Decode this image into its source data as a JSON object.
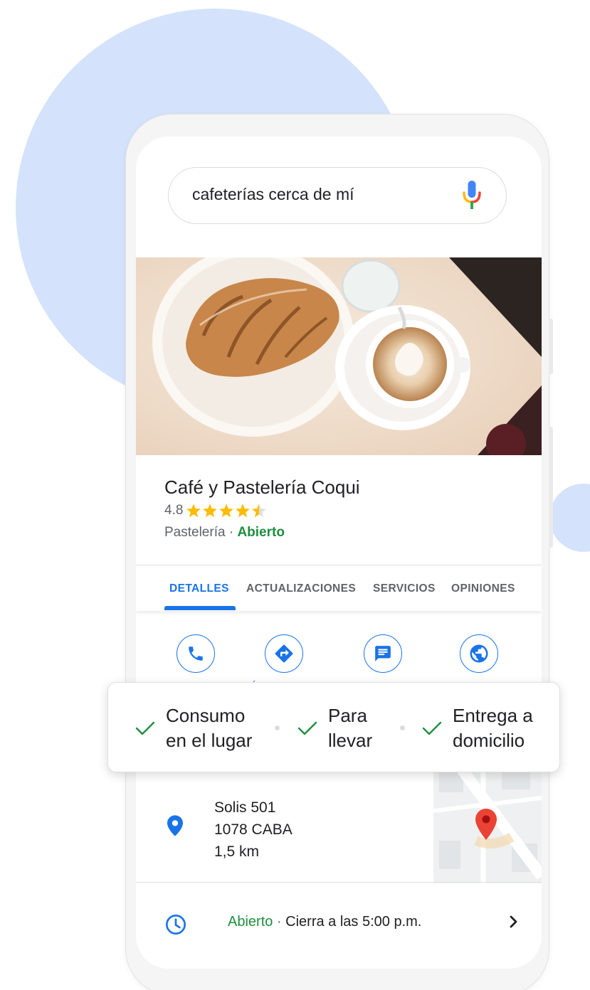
{
  "search": {
    "query": "cafeterías cerca de mí"
  },
  "business": {
    "name": "Café y Pastelería Coqui",
    "rating": "4.8",
    "stars": 4.5,
    "category": "Pastelería",
    "separator": " · ",
    "status": "Abierto"
  },
  "tabs": [
    {
      "label": "DETALLES",
      "active": true
    },
    {
      "label": "ACTUALIZACIONES",
      "active": false
    },
    {
      "label": "SERVICIOS",
      "active": false
    },
    {
      "label": "OPINIONES",
      "active": false
    }
  ],
  "actions": [
    {
      "icon": "phone-icon"
    },
    {
      "icon": "directions-icon"
    },
    {
      "icon": "message-icon"
    },
    {
      "icon": "website-icon"
    }
  ],
  "features": [
    {
      "label": "Consumo\nen el lugar"
    },
    {
      "label": "Para\nllevar"
    },
    {
      "label": "Entrega a\ndomicilio"
    }
  ],
  "address": {
    "line1": "Solis 501",
    "line2": "1078 CABA",
    "distance": "1,5 km"
  },
  "hours": {
    "status": "Abierto",
    "separator": " · ",
    "closes": "Cierra a las 5:00 p.m."
  },
  "colors": {
    "accent": "#1a73e8",
    "open": "#1e8e3e",
    "star": "#fbbc04",
    "blob": "#d4e3fb"
  }
}
